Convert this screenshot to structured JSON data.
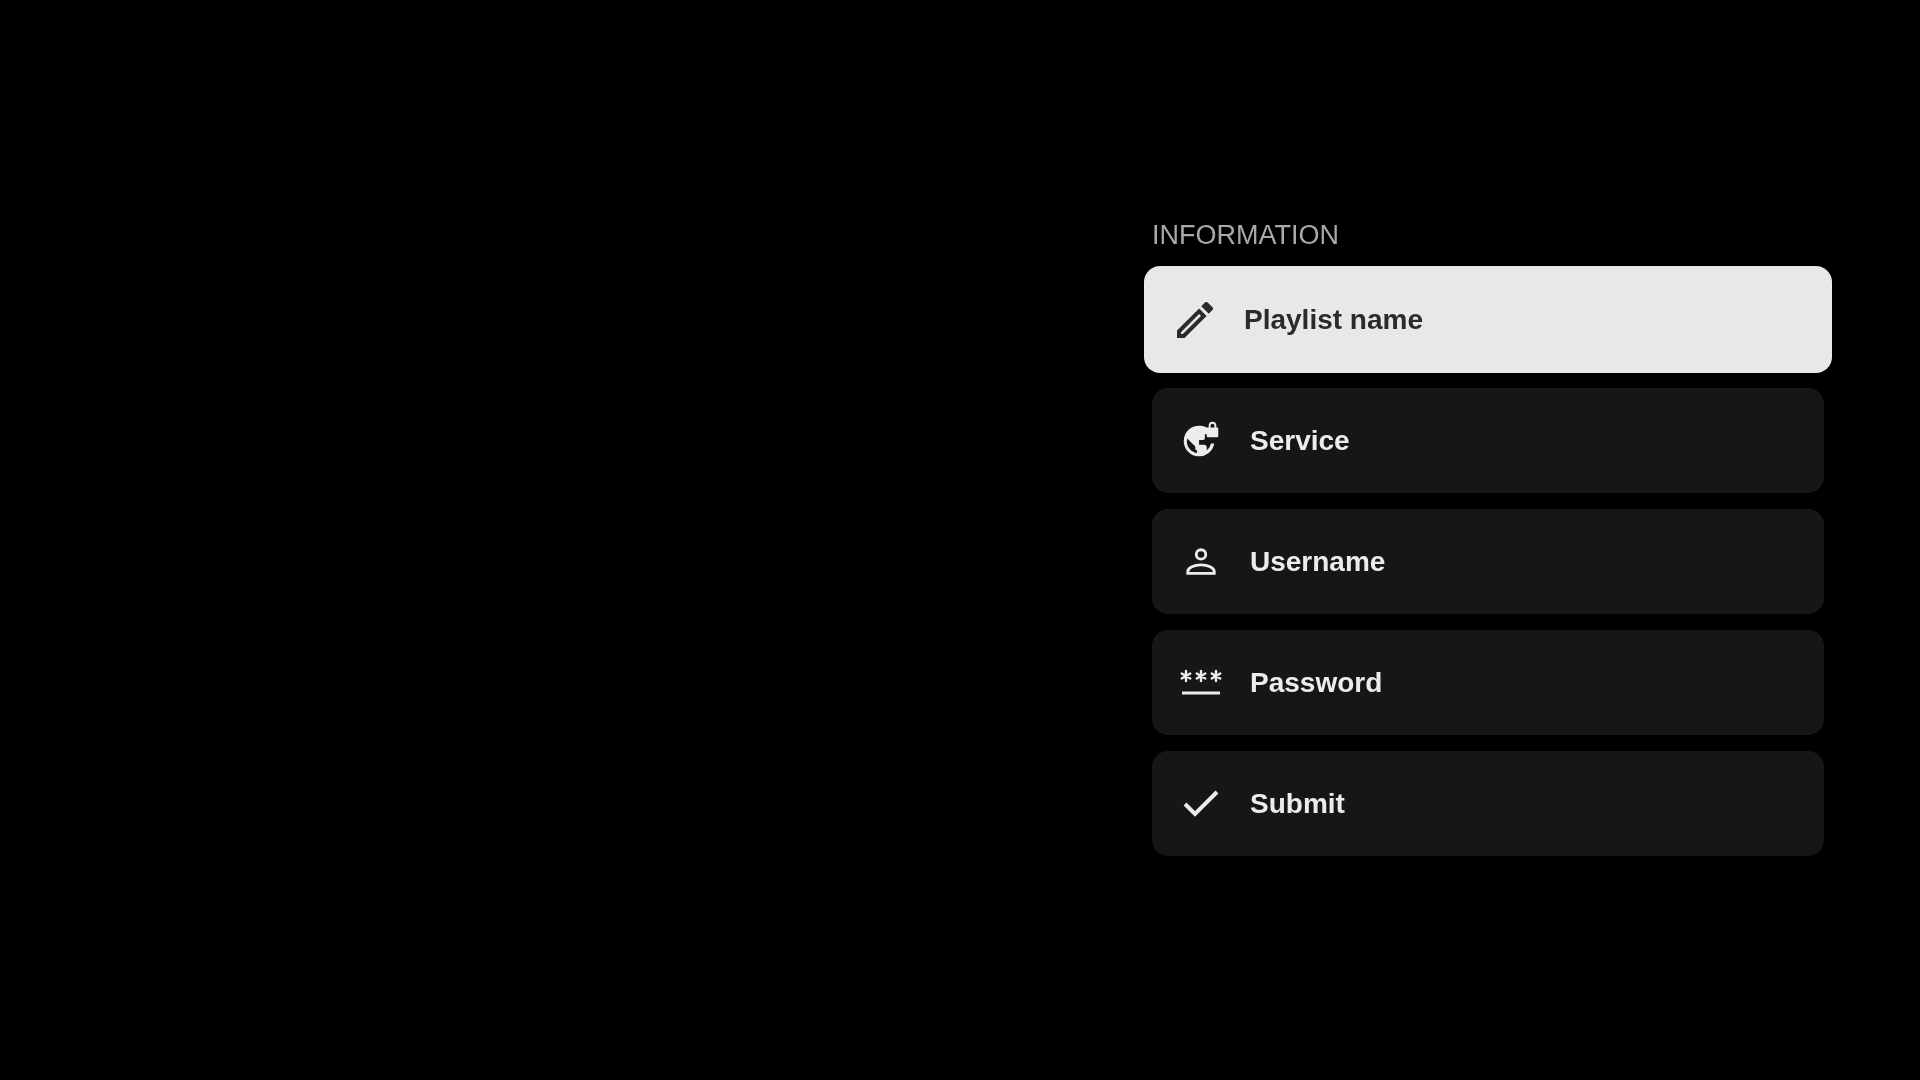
{
  "section": {
    "title": "INFORMATION"
  },
  "items": [
    {
      "kind": "edit",
      "label": "Playlist name",
      "selected": true
    },
    {
      "kind": "service",
      "label": "Service",
      "selected": false
    },
    {
      "kind": "user",
      "label": "Username",
      "selected": false
    },
    {
      "kind": "password",
      "label": "Password",
      "selected": false
    },
    {
      "kind": "submit",
      "label": "Submit",
      "selected": false
    }
  ]
}
